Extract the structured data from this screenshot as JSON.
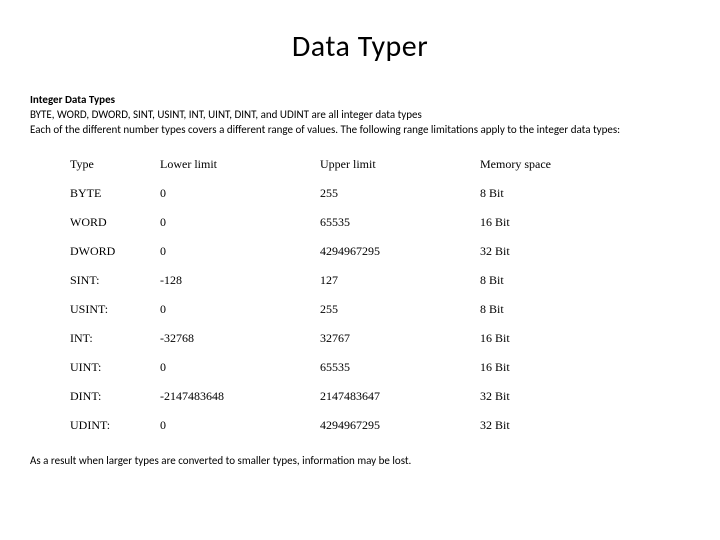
{
  "title": "Data Typer",
  "intro": {
    "subhead": "Integer Data Types",
    "line1": "BYTE, WORD, DWORD, SINT, USINT, INT, UINT, DINT, and UDINT are all integer data types",
    "line2": "Each of the different number types covers a different range of values. The following range limitations apply to the integer data types:"
  },
  "table": {
    "headers": {
      "type": "Type",
      "lower": "Lower limit",
      "upper": "Upper limit",
      "mem": "Memory space"
    },
    "rows": [
      {
        "type": "BYTE",
        "lower": "0",
        "upper": "255",
        "mem": "8 Bit"
      },
      {
        "type": "WORD",
        "lower": "0",
        "upper": "65535",
        "mem": "16 Bit"
      },
      {
        "type": "DWORD",
        "lower": "0",
        "upper": "4294967295",
        "mem": "32 Bit"
      },
      {
        "type": "SINT:",
        "lower": "-128",
        "upper": "127",
        "mem": "8 Bit"
      },
      {
        "type": "USINT:",
        "lower": "0",
        "upper": "255",
        "mem": "8 Bit"
      },
      {
        "type": "INT:",
        "lower": "-32768",
        "upper": "32767",
        "mem": "16 Bit"
      },
      {
        "type": "UINT:",
        "lower": "0",
        "upper": "65535",
        "mem": "16 Bit"
      },
      {
        "type": "DINT:",
        "lower": "-2147483648",
        "upper": "2147483647",
        "mem": "32 Bit"
      },
      {
        "type": "UDINT:",
        "lower": "0",
        "upper": "4294967295",
        "mem": "32 Bit"
      }
    ]
  },
  "outro": "As a result when larger types are converted to smaller types, information may be lost."
}
